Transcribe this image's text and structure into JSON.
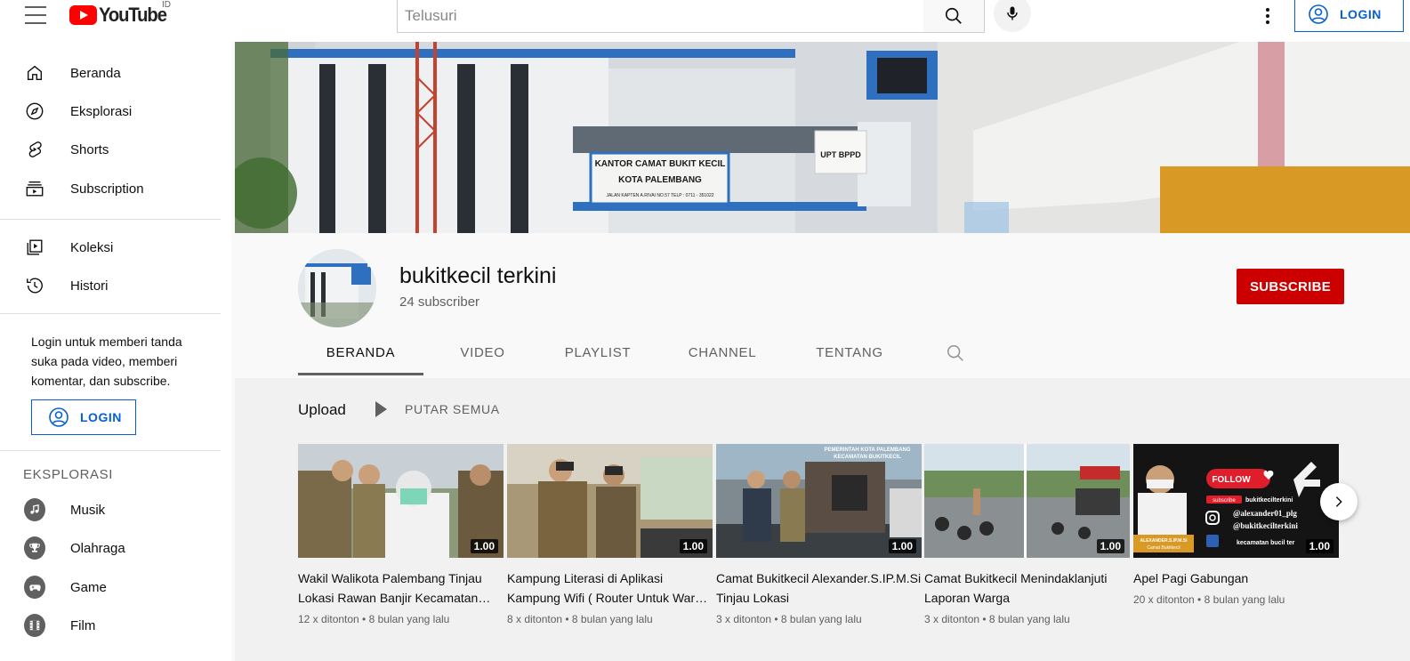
{
  "header": {
    "logo_text": "YouTube",
    "country_code": "ID",
    "search_placeholder": "Telusuri",
    "login_label": "LOGIN"
  },
  "sidebar": {
    "main": [
      {
        "label": "Beranda",
        "icon": "home-icon"
      },
      {
        "label": "Eksplorasi",
        "icon": "compass-icon"
      },
      {
        "label": "Shorts",
        "icon": "shorts-icon"
      },
      {
        "label": "Subscription",
        "icon": "subscriptions-icon"
      }
    ],
    "library": [
      {
        "label": "Koleksi",
        "icon": "library-icon"
      },
      {
        "label": "Histori",
        "icon": "history-icon"
      }
    ],
    "login_note": "Login untuk memberi tanda suka pada video, memberi komentar, dan subscribe.",
    "login_label": "LOGIN",
    "explore_title": "EKSPLORASI",
    "explore": [
      {
        "label": "Musik",
        "icon": "music-icon"
      },
      {
        "label": "Olahraga",
        "icon": "trophy-icon"
      },
      {
        "label": "Game",
        "icon": "gamepad-icon"
      },
      {
        "label": "Film",
        "icon": "film-icon"
      }
    ]
  },
  "channel": {
    "name": "bukitkecil terkini",
    "subscribers": "24 subscriber",
    "subscribe_label": "SUBSCRIBE",
    "tabs": [
      {
        "label": "BERANDA",
        "active": true
      },
      {
        "label": "VIDEO",
        "active": false
      },
      {
        "label": "PLAYLIST",
        "active": false
      },
      {
        "label": "CHANNEL",
        "active": false
      },
      {
        "label": "TENTANG",
        "active": false
      }
    ],
    "banner_sign_line1": "KANTOR CAMAT BUKIT KECIL",
    "banner_sign_line2": "KOTA PALEMBANG",
    "banner_sign_line3": "JALAN KAPTEN A.RIVAI NO.57 TELP : 0711 - 351022",
    "banner_sign2": "UPT BPPD"
  },
  "shelf": {
    "title": "Upload",
    "play_all": "PUTAR SEMUA",
    "videos": [
      {
        "title": "Wakil Walikota Palembang Tinjau Lokasi Rawan Banjir Kecamatan Bukit Kecil",
        "duration": "1.00",
        "views": "12 x ditonton",
        "age": "8 bulan yang lalu",
        "color": "#7a6a4a"
      },
      {
        "title": "Kampung Literasi di Aplikasi Kampung Wifi ( Router Untuk Warga )",
        "duration": "1.00",
        "views": "8 x ditonton",
        "age": "8 bulan yang lalu",
        "color": "#6b5c46"
      },
      {
        "title": "Camat Bukitkecil Alexander.S.IP.M.Si Tinjau Lokasi",
        "duration": "1.00",
        "views": "3 x ditonton",
        "age": "8 bulan yang lalu",
        "color": "#5d6a72"
      },
      {
        "title": "Camat Bukitkecil Menindaklanjuti Laporan Warga",
        "duration": "1.00",
        "views": "3 x ditonton",
        "age": "8 bulan yang lalu",
        "color": "#7f8c7a"
      },
      {
        "title": "Apel Pagi Gabungan",
        "duration": "1.00",
        "views": "20 x ditonton",
        "age": "8 bulan yang lalu",
        "color": "#1b1b1b"
      }
    ],
    "thumb5_follow": "FOLLOW",
    "thumb5_subscribe": "subscribe",
    "thumb5_channel": "bukitkecilterkini",
    "thumb5_ig1": "@alexander01_plg",
    "thumb5_ig2": "@bukitkecilterkini",
    "thumb5_fb": "kecamatan bucil ter",
    "thumb5_name": "ALEXANDER.S.IP.M.Si",
    "thumb5_role": "Camat Bukitkecil",
    "thumb3_caption1": "PEMERINTAH KOTA PALEMBANG",
    "thumb3_caption2": "KECAMATAN BUKITKECIL"
  }
}
